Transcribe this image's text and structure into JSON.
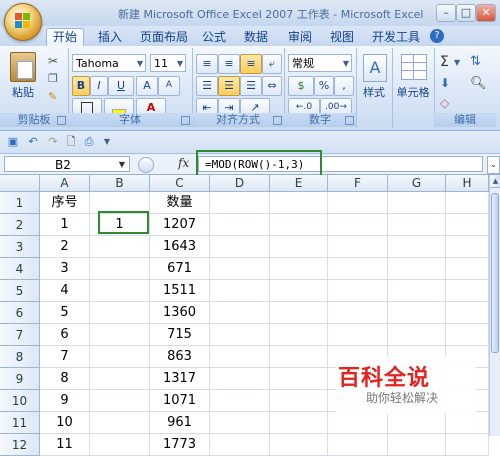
{
  "window": {
    "title": "新建 Microsoft Office Excel 2007 工作表 - Microsoft Excel",
    "controls": {
      "minimize": "–",
      "maximize": "□",
      "close": "✕"
    }
  },
  "tabs": [
    {
      "label": "开始",
      "active": true
    },
    {
      "label": "插入"
    },
    {
      "label": "页面布局"
    },
    {
      "label": "公式"
    },
    {
      "label": "数据"
    },
    {
      "label": "审阅"
    },
    {
      "label": "视图"
    },
    {
      "label": "开发工具"
    }
  ],
  "ribbon": {
    "clipboard": {
      "paste_label": "粘贴",
      "group_label": "剪贴板"
    },
    "font": {
      "name": "Tahoma",
      "size": "11",
      "group_label": "字体",
      "bold": "B",
      "italic": "I",
      "underline": "U",
      "grow": "A",
      "shrink": "A"
    },
    "alignment": {
      "group_label": "对齐方式"
    },
    "number": {
      "format": "常规",
      "currency": "$",
      "percent": "%",
      "comma": ",",
      "group_label": "数字"
    },
    "styles": {
      "label": "样式"
    },
    "cells": {
      "label": "单元格"
    },
    "editing": {
      "group_label": "编辑",
      "sum": "Σ"
    }
  },
  "formula_bar": {
    "name_box": "B2",
    "fx": "fx",
    "formula": "=MOD(ROW()-1,3)"
  },
  "sheet": {
    "columns": [
      "A",
      "B",
      "C",
      "D",
      "E",
      "F",
      "G",
      "H"
    ],
    "rows": [
      {
        "n": "1",
        "A": "序号",
        "B": "",
        "C": "数量"
      },
      {
        "n": "2",
        "A": "1",
        "B": "1",
        "C": "1207"
      },
      {
        "n": "3",
        "A": "2",
        "B": "",
        "C": "1643"
      },
      {
        "n": "4",
        "A": "3",
        "B": "",
        "C": "671"
      },
      {
        "n": "5",
        "A": "4",
        "B": "",
        "C": "1511"
      },
      {
        "n": "6",
        "A": "5",
        "B": "",
        "C": "1360"
      },
      {
        "n": "7",
        "A": "6",
        "B": "",
        "C": "715"
      },
      {
        "n": "8",
        "A": "7",
        "B": "",
        "C": "863"
      },
      {
        "n": "9",
        "A": "8",
        "B": "",
        "C": "1317"
      },
      {
        "n": "10",
        "A": "9",
        "B": "",
        "C": "1071"
      },
      {
        "n": "11",
        "A": "10",
        "B": "",
        "C": "961"
      },
      {
        "n": "12",
        "A": "11",
        "B": "",
        "C": "1773"
      }
    ],
    "selected_cell": "B2"
  },
  "watermark": {
    "title": "百科全说",
    "subtitle": "助你轻松解决"
  },
  "colors": {
    "highlight": "#2e8b2e",
    "ribbon": "#d9e6f6",
    "accent_red": "#e3231f"
  }
}
